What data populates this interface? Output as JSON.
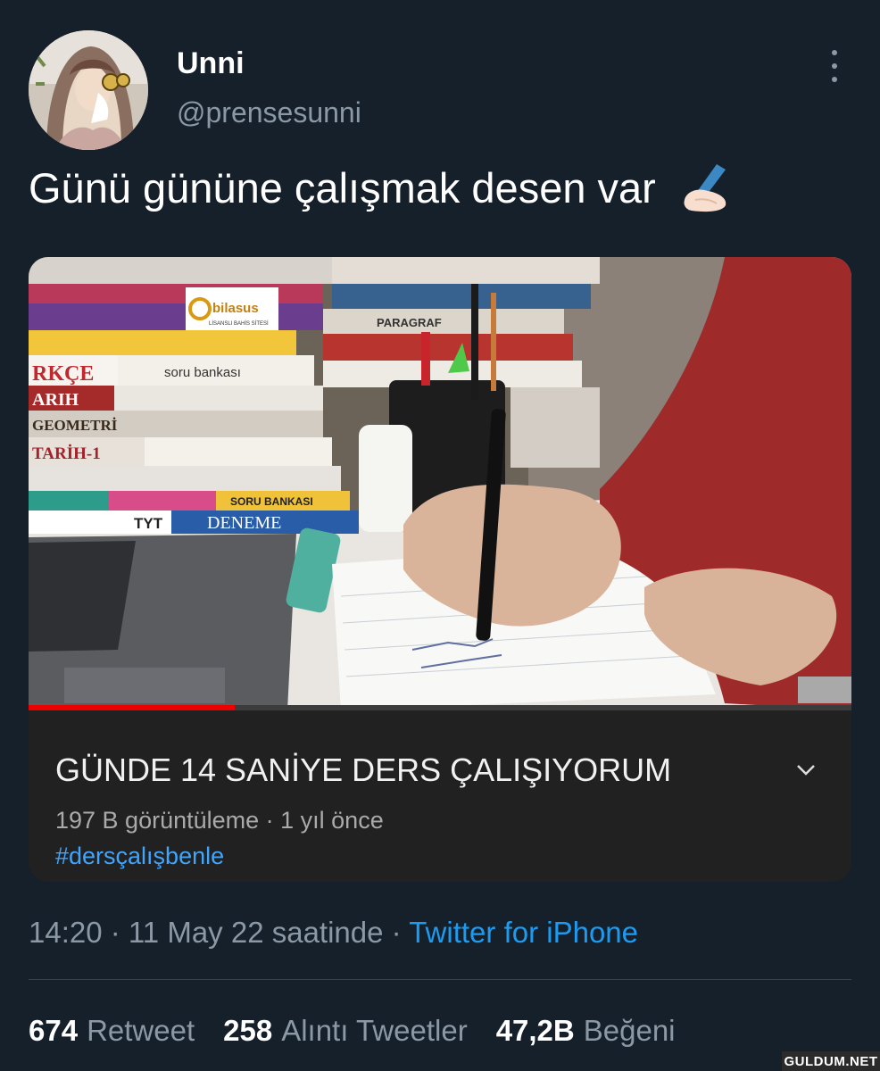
{
  "user": {
    "display_name": "Unni",
    "handle": "@prensesunni",
    "avatar_icon": "avatar-photo"
  },
  "tweet": {
    "text": "Günü gününe çalışmak desen var",
    "emoji_icon": "writing-hand-icon"
  },
  "video_card": {
    "thumbnail_overlay_logo": {
      "brand": "bilasus",
      "tagline": "LİSANSLI BAHİS SİTESİ"
    },
    "thumbnail_book_labels": [
      "RKÇE",
      "soru bankası",
      "ARIH",
      "GEOMETRİ",
      "TARİH-1",
      "TYT",
      "DENEME",
      "SORU BANKASI",
      "PARAGRAF"
    ],
    "title": "GÜNDE 14 SANİYE DERS ÇALIŞIYORUM",
    "meta": "197 B görüntüleme · 1 yıl önce",
    "hashtag": "#dersçalışbenle",
    "progress_fraction": 0.25
  },
  "timestamp": {
    "time": "14:20 · 11 May 22 saatinde · ",
    "source": "Twitter for iPhone"
  },
  "stats": {
    "retweets": {
      "count": "674",
      "label": "Retweet"
    },
    "quotes": {
      "count": "258",
      "label": "Alıntı Tweetler"
    },
    "likes": {
      "count": "47,2B",
      "label": "Beğeni"
    }
  },
  "watermark": "GULDUM.NET",
  "colors": {
    "background": "#15202b",
    "secondary_text": "#8b98a5",
    "link": "#1d9bf0",
    "youtube_red": "#ee0000",
    "youtube_link": "#3ea6ff"
  }
}
